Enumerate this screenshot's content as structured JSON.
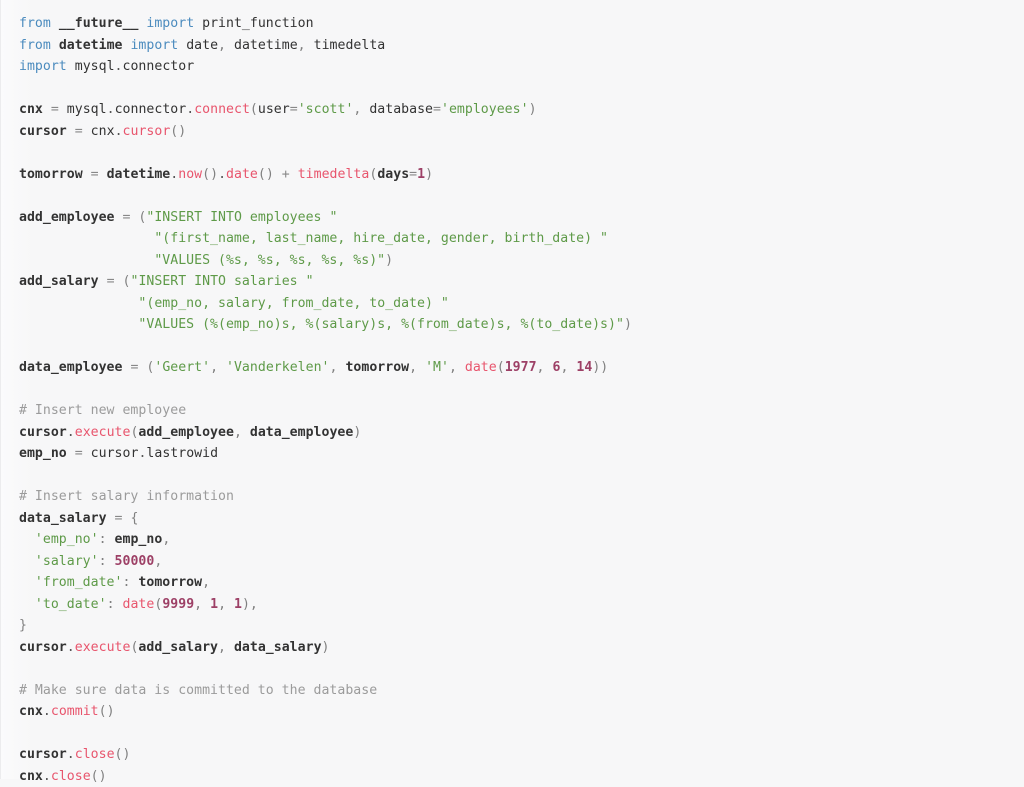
{
  "editor": {
    "language": "python",
    "background_color": "#f7f7f8",
    "default_text_color": "#333333",
    "colors": {
      "keyword": "#4b8bbe",
      "function_call": "#e8556d",
      "string": "#5e9a48",
      "number": "#9d4066",
      "comment": "#9b9b9b",
      "operator": "#888888",
      "punctuation": "#808080",
      "identifier": "#333333"
    },
    "plain_text": "from __future__ import print_function\nfrom datetime import date, datetime, timedelta\nimport mysql.connector\n\ncnx = mysql.connector.connect(user='scott', database='employees')\ncursor = cnx.cursor()\n\ntomorrow = datetime.now().date() + timedelta(days=1)\n\nadd_employee = (\"INSERT INTO employees \"\n               \"(first_name, last_name, hire_date, gender, birth_date) \"\n               \"VALUES (%s, %s, %s, %s, %s)\")\nadd_salary = (\"INSERT INTO salaries \"\n              \"(emp_no, salary, from_date, to_date) \"\n              \"VALUES (%(emp_no)s, %(salary)s, %(from_date)s, %(to_date)s)\")\n\ndata_employee = ('Geert', 'Vanderkelen', tomorrow, 'M', date(1977, 6, 14))\n\n# Insert new employee\ncursor.execute(add_employee, data_employee)\nemp_no = cursor.lastrowid\n\n# Insert salary information\ndata_salary = {\n  'emp_no': emp_no,\n  'salary': 50000,\n  'from_date': tomorrow,\n  'to_date': date(9999, 1, 1),\n}\ncursor.execute(add_salary, data_salary)\n\n# Make sure data is committed to the database\ncnx.commit()\n\ncursor.close()\ncnx.close()",
    "lines": [
      {
        "n": 1,
        "tokens": [
          {
            "t": "kw",
            "v": "from"
          },
          {
            "t": "plain",
            "v": " "
          },
          {
            "t": "name",
            "v": "__future__"
          },
          {
            "t": "plain",
            "v": " "
          },
          {
            "t": "kw",
            "v": "import"
          },
          {
            "t": "plain",
            "v": " "
          },
          {
            "t": "plain",
            "v": "print_function"
          }
        ]
      },
      {
        "n": 2,
        "tokens": [
          {
            "t": "kw",
            "v": "from"
          },
          {
            "t": "plain",
            "v": " "
          },
          {
            "t": "name",
            "v": "datetime"
          },
          {
            "t": "plain",
            "v": " "
          },
          {
            "t": "kw",
            "v": "import"
          },
          {
            "t": "plain",
            "v": " "
          },
          {
            "t": "plain",
            "v": "date"
          },
          {
            "t": "punc",
            "v": ","
          },
          {
            "t": "plain",
            "v": " "
          },
          {
            "t": "plain",
            "v": "datetime"
          },
          {
            "t": "punc",
            "v": ","
          },
          {
            "t": "plain",
            "v": " "
          },
          {
            "t": "plain",
            "v": "timedelta"
          }
        ]
      },
      {
        "n": 3,
        "tokens": [
          {
            "t": "kw",
            "v": "import"
          },
          {
            "t": "plain",
            "v": " "
          },
          {
            "t": "plain",
            "v": "mysql"
          },
          {
            "t": "dot",
            "v": "."
          },
          {
            "t": "plain",
            "v": "connector"
          }
        ]
      },
      {
        "n": 4,
        "tokens": []
      },
      {
        "n": 5,
        "tokens": [
          {
            "t": "name",
            "v": "cnx"
          },
          {
            "t": "plain",
            "v": " "
          },
          {
            "t": "op",
            "v": "="
          },
          {
            "t": "plain",
            "v": " "
          },
          {
            "t": "plain",
            "v": "mysql"
          },
          {
            "t": "dot",
            "v": "."
          },
          {
            "t": "plain",
            "v": "connector"
          },
          {
            "t": "dot",
            "v": "."
          },
          {
            "t": "fn",
            "v": "connect"
          },
          {
            "t": "punc",
            "v": "("
          },
          {
            "t": "plain",
            "v": "user"
          },
          {
            "t": "op",
            "v": "="
          },
          {
            "t": "str",
            "v": "'scott'"
          },
          {
            "t": "punc",
            "v": ","
          },
          {
            "t": "plain",
            "v": " "
          },
          {
            "t": "plain",
            "v": "database"
          },
          {
            "t": "op",
            "v": "="
          },
          {
            "t": "str",
            "v": "'employees'"
          },
          {
            "t": "punc",
            "v": ")"
          }
        ]
      },
      {
        "n": 6,
        "tokens": [
          {
            "t": "name",
            "v": "cursor"
          },
          {
            "t": "plain",
            "v": " "
          },
          {
            "t": "op",
            "v": "="
          },
          {
            "t": "plain",
            "v": " "
          },
          {
            "t": "plain",
            "v": "cnx"
          },
          {
            "t": "dot",
            "v": "."
          },
          {
            "t": "fn",
            "v": "cursor"
          },
          {
            "t": "punc",
            "v": "()"
          }
        ]
      },
      {
        "n": 7,
        "tokens": []
      },
      {
        "n": 8,
        "tokens": [
          {
            "t": "name",
            "v": "tomorrow"
          },
          {
            "t": "plain",
            "v": " "
          },
          {
            "t": "op",
            "v": "="
          },
          {
            "t": "plain",
            "v": " "
          },
          {
            "t": "name",
            "v": "datetime"
          },
          {
            "t": "dot",
            "v": "."
          },
          {
            "t": "fn",
            "v": "now"
          },
          {
            "t": "punc",
            "v": "()"
          },
          {
            "t": "dot",
            "v": "."
          },
          {
            "t": "fn",
            "v": "date"
          },
          {
            "t": "punc",
            "v": "()"
          },
          {
            "t": "plain",
            "v": " "
          },
          {
            "t": "op",
            "v": "+"
          },
          {
            "t": "plain",
            "v": " "
          },
          {
            "t": "fn",
            "v": "timedelta"
          },
          {
            "t": "punc",
            "v": "("
          },
          {
            "t": "name",
            "v": "days"
          },
          {
            "t": "op",
            "v": "="
          },
          {
            "t": "num",
            "v": "1"
          },
          {
            "t": "punc",
            "v": ")"
          }
        ]
      },
      {
        "n": 9,
        "tokens": []
      },
      {
        "n": 10,
        "tokens": [
          {
            "t": "name",
            "v": "add_employee"
          },
          {
            "t": "plain",
            "v": " "
          },
          {
            "t": "op",
            "v": "="
          },
          {
            "t": "plain",
            "v": " "
          },
          {
            "t": "punc",
            "v": "("
          },
          {
            "t": "str",
            "v": "\"INSERT INTO employees \""
          }
        ]
      },
      {
        "n": 11,
        "tokens": [
          {
            "t": "plain",
            "v": "                 "
          },
          {
            "t": "str",
            "v": "\"(first_name, last_name, hire_date, gender, birth_date) \""
          }
        ]
      },
      {
        "n": 12,
        "tokens": [
          {
            "t": "plain",
            "v": "                 "
          },
          {
            "t": "str",
            "v": "\"VALUES (%s, %s, %s, %s, %s)\""
          },
          {
            "t": "punc",
            "v": ")"
          }
        ]
      },
      {
        "n": 13,
        "tokens": [
          {
            "t": "name",
            "v": "add_salary"
          },
          {
            "t": "plain",
            "v": " "
          },
          {
            "t": "op",
            "v": "="
          },
          {
            "t": "plain",
            "v": " "
          },
          {
            "t": "punc",
            "v": "("
          },
          {
            "t": "str",
            "v": "\"INSERT INTO salaries \""
          }
        ]
      },
      {
        "n": 14,
        "tokens": [
          {
            "t": "plain",
            "v": "               "
          },
          {
            "t": "str",
            "v": "\"(emp_no, salary, from_date, to_date) \""
          }
        ]
      },
      {
        "n": 15,
        "tokens": [
          {
            "t": "plain",
            "v": "               "
          },
          {
            "t": "str",
            "v": "\"VALUES (%(emp_no)s, %(salary)s, %(from_date)s, %(to_date)s)\""
          },
          {
            "t": "punc",
            "v": ")"
          }
        ]
      },
      {
        "n": 16,
        "tokens": []
      },
      {
        "n": 17,
        "tokens": [
          {
            "t": "name",
            "v": "data_employee"
          },
          {
            "t": "plain",
            "v": " "
          },
          {
            "t": "op",
            "v": "="
          },
          {
            "t": "plain",
            "v": " "
          },
          {
            "t": "punc",
            "v": "("
          },
          {
            "t": "str",
            "v": "'Geert'"
          },
          {
            "t": "punc",
            "v": ","
          },
          {
            "t": "plain",
            "v": " "
          },
          {
            "t": "str",
            "v": "'Vanderkelen'"
          },
          {
            "t": "punc",
            "v": ","
          },
          {
            "t": "plain",
            "v": " "
          },
          {
            "t": "name",
            "v": "tomorrow"
          },
          {
            "t": "punc",
            "v": ","
          },
          {
            "t": "plain",
            "v": " "
          },
          {
            "t": "str",
            "v": "'M'"
          },
          {
            "t": "punc",
            "v": ","
          },
          {
            "t": "plain",
            "v": " "
          },
          {
            "t": "fn",
            "v": "date"
          },
          {
            "t": "punc",
            "v": "("
          },
          {
            "t": "num",
            "v": "1977"
          },
          {
            "t": "punc",
            "v": ","
          },
          {
            "t": "plain",
            "v": " "
          },
          {
            "t": "num",
            "v": "6"
          },
          {
            "t": "punc",
            "v": ","
          },
          {
            "t": "plain",
            "v": " "
          },
          {
            "t": "num",
            "v": "14"
          },
          {
            "t": "punc",
            "v": "))"
          }
        ]
      },
      {
        "n": 18,
        "tokens": []
      },
      {
        "n": 19,
        "tokens": [
          {
            "t": "com",
            "v": "# Insert new employee"
          }
        ]
      },
      {
        "n": 20,
        "tokens": [
          {
            "t": "name",
            "v": "cursor"
          },
          {
            "t": "dot",
            "v": "."
          },
          {
            "t": "fn",
            "v": "execute"
          },
          {
            "t": "punc",
            "v": "("
          },
          {
            "t": "name",
            "v": "add_employee"
          },
          {
            "t": "punc",
            "v": ","
          },
          {
            "t": "plain",
            "v": " "
          },
          {
            "t": "name",
            "v": "data_employee"
          },
          {
            "t": "punc",
            "v": ")"
          }
        ]
      },
      {
        "n": 21,
        "tokens": [
          {
            "t": "name",
            "v": "emp_no"
          },
          {
            "t": "plain",
            "v": " "
          },
          {
            "t": "op",
            "v": "="
          },
          {
            "t": "plain",
            "v": " "
          },
          {
            "t": "plain",
            "v": "cursor"
          },
          {
            "t": "dot",
            "v": "."
          },
          {
            "t": "plain",
            "v": "lastrowid"
          }
        ]
      },
      {
        "n": 22,
        "tokens": []
      },
      {
        "n": 23,
        "tokens": [
          {
            "t": "com",
            "v": "# Insert salary information"
          }
        ]
      },
      {
        "n": 24,
        "tokens": [
          {
            "t": "name",
            "v": "data_salary"
          },
          {
            "t": "plain",
            "v": " "
          },
          {
            "t": "op",
            "v": "="
          },
          {
            "t": "plain",
            "v": " "
          },
          {
            "t": "punc",
            "v": "{"
          }
        ]
      },
      {
        "n": 25,
        "tokens": [
          {
            "t": "plain",
            "v": "  "
          },
          {
            "t": "str",
            "v": "'emp_no'"
          },
          {
            "t": "punc",
            "v": ":"
          },
          {
            "t": "plain",
            "v": " "
          },
          {
            "t": "name",
            "v": "emp_no"
          },
          {
            "t": "punc",
            "v": ","
          }
        ]
      },
      {
        "n": 26,
        "tokens": [
          {
            "t": "plain",
            "v": "  "
          },
          {
            "t": "str",
            "v": "'salary'"
          },
          {
            "t": "punc",
            "v": ":"
          },
          {
            "t": "plain",
            "v": " "
          },
          {
            "t": "num",
            "v": "50000"
          },
          {
            "t": "punc",
            "v": ","
          }
        ]
      },
      {
        "n": 27,
        "tokens": [
          {
            "t": "plain",
            "v": "  "
          },
          {
            "t": "str",
            "v": "'from_date'"
          },
          {
            "t": "punc",
            "v": ":"
          },
          {
            "t": "plain",
            "v": " "
          },
          {
            "t": "name",
            "v": "tomorrow"
          },
          {
            "t": "punc",
            "v": ","
          }
        ]
      },
      {
        "n": 28,
        "tokens": [
          {
            "t": "plain",
            "v": "  "
          },
          {
            "t": "str",
            "v": "'to_date'"
          },
          {
            "t": "punc",
            "v": ":"
          },
          {
            "t": "plain",
            "v": " "
          },
          {
            "t": "fn",
            "v": "date"
          },
          {
            "t": "punc",
            "v": "("
          },
          {
            "t": "num",
            "v": "9999"
          },
          {
            "t": "punc",
            "v": ","
          },
          {
            "t": "plain",
            "v": " "
          },
          {
            "t": "num",
            "v": "1"
          },
          {
            "t": "punc",
            "v": ","
          },
          {
            "t": "plain",
            "v": " "
          },
          {
            "t": "num",
            "v": "1"
          },
          {
            "t": "punc",
            "v": "),"
          }
        ]
      },
      {
        "n": 29,
        "tokens": [
          {
            "t": "punc",
            "v": "}"
          }
        ]
      },
      {
        "n": 30,
        "tokens": [
          {
            "t": "name",
            "v": "cursor"
          },
          {
            "t": "dot",
            "v": "."
          },
          {
            "t": "fn",
            "v": "execute"
          },
          {
            "t": "punc",
            "v": "("
          },
          {
            "t": "name",
            "v": "add_salary"
          },
          {
            "t": "punc",
            "v": ","
          },
          {
            "t": "plain",
            "v": " "
          },
          {
            "t": "name",
            "v": "data_salary"
          },
          {
            "t": "punc",
            "v": ")"
          }
        ]
      },
      {
        "n": 31,
        "tokens": []
      },
      {
        "n": 32,
        "tokens": [
          {
            "t": "com",
            "v": "# Make sure data is committed to the database"
          }
        ]
      },
      {
        "n": 33,
        "tokens": [
          {
            "t": "name",
            "v": "cnx"
          },
          {
            "t": "dot",
            "v": "."
          },
          {
            "t": "fn",
            "v": "commit"
          },
          {
            "t": "punc",
            "v": "()"
          }
        ]
      },
      {
        "n": 34,
        "tokens": []
      },
      {
        "n": 35,
        "tokens": [
          {
            "t": "name",
            "v": "cursor"
          },
          {
            "t": "dot",
            "v": "."
          },
          {
            "t": "fn",
            "v": "close"
          },
          {
            "t": "punc",
            "v": "()"
          }
        ]
      },
      {
        "n": 36,
        "tokens": [
          {
            "t": "name",
            "v": "cnx"
          },
          {
            "t": "dot",
            "v": "."
          },
          {
            "t": "fn",
            "v": "close"
          },
          {
            "t": "punc",
            "v": "()"
          }
        ]
      }
    ]
  }
}
